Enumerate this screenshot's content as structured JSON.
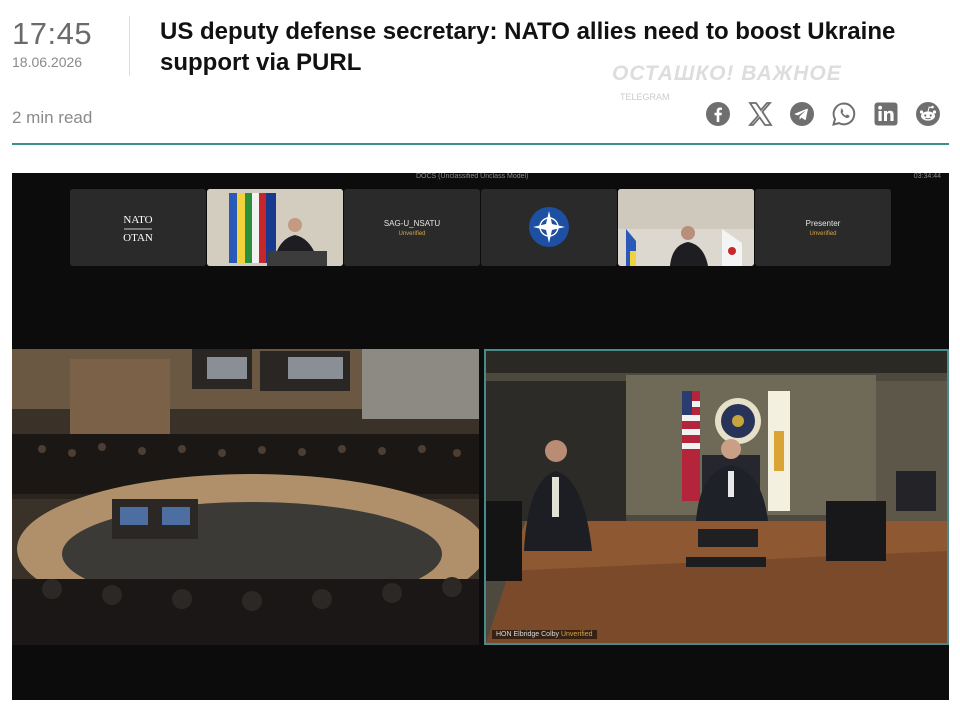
{
  "header": {
    "time": "17:45",
    "date": "18.06.2026",
    "title": "US deputy defense secretary: NATO allies need to boost Ukraine support via PURL",
    "read_time": "2 min read"
  },
  "watermark": {
    "text": "ОСТАШКО! ВАЖНОЕ",
    "sub": "TELEGRAM"
  },
  "share": {
    "icons": [
      "facebook-icon",
      "x-icon",
      "telegram-icon",
      "whatsapp-icon",
      "linkedin-icon",
      "reddit-icon"
    ]
  },
  "video": {
    "topbar_text": "DOCS (Unclassified Unclass Model)",
    "topbar_right": "03:34:44",
    "tiles": [
      {
        "name": "NATO\nOTAN",
        "sub": ""
      },
      {
        "name": "",
        "sub": ""
      },
      {
        "name": "SAG-U_NSATU",
        "sub": "Unverified"
      },
      {
        "name": "",
        "sub": ""
      },
      {
        "name": "",
        "sub": ""
      },
      {
        "name": "Presenter",
        "sub": "Unverified"
      }
    ],
    "speaker_label": "HON Elbridge Colby",
    "speaker_status": "Unverified"
  },
  "colors": {
    "accent_rule": "#3e8f8a",
    "text_muted": "#8a8a8a",
    "icon_gray": "#6f6f6f"
  }
}
